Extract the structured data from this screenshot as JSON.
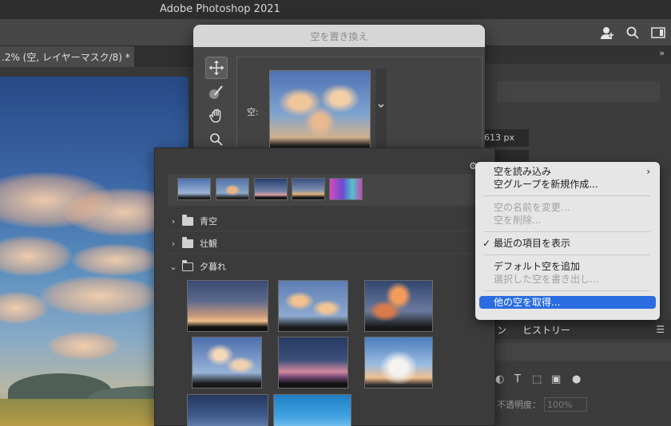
{
  "app": {
    "title": "Adobe Photoshop 2021"
  },
  "document": {
    "tab_label": ".2% (空, レイヤーマスク/8) *"
  },
  "optionsbar": {
    "icons": [
      "share-icon",
      "search-icon",
      "workspace-icon"
    ]
  },
  "dialog": {
    "title": "空を置き換え",
    "sky_label": "空:",
    "tools": [
      "move-sky-icon",
      "sky-brush-icon",
      "hand-icon",
      "zoom-icon"
    ]
  },
  "sky_picker": {
    "recent_count": 5,
    "groups": [
      {
        "label": "青空",
        "expanded": false
      },
      {
        "label": "壮観",
        "expanded": false
      },
      {
        "label": "夕暮れ",
        "expanded": true
      }
    ]
  },
  "context_menu": {
    "items": [
      {
        "label": "空を読み込み",
        "enabled": true,
        "submenu": true
      },
      {
        "label": "空グループを新規作成...",
        "enabled": true
      },
      {
        "label": "空の名前を変更...",
        "enabled": false
      },
      {
        "label": "空を削除...",
        "enabled": false
      },
      {
        "label": "最近の項目を表示",
        "enabled": true,
        "checked": true
      },
      {
        "label": "デフォルト空を追加",
        "enabled": true
      },
      {
        "label": "選択した空を書き出し...",
        "enabled": false
      },
      {
        "label": "他の空を取得...",
        "enabled": true,
        "highlighted": true
      }
    ]
  },
  "right_panel": {
    "size_value": "613 px",
    "tab_left_label": "ン",
    "tab_history_label": "ヒストリー",
    "opacity_label": "不透明度：",
    "opacity_value": "100%"
  },
  "colors": {
    "highlight": "#2a6de0",
    "dialog_bg": "#464646",
    "menu_bg": "#e6e6e6"
  }
}
